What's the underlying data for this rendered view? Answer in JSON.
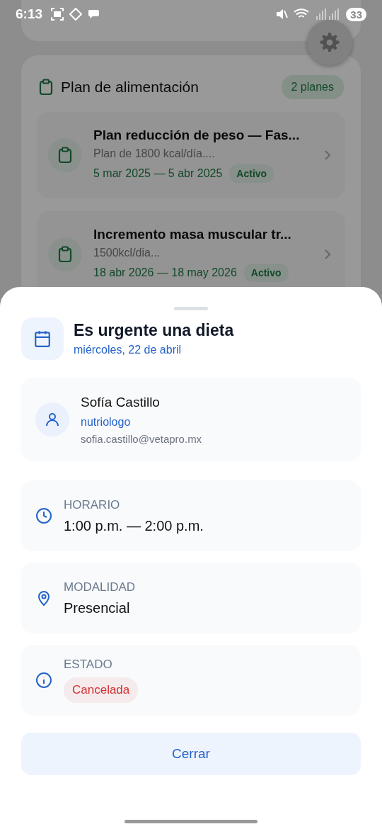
{
  "status_bar": {
    "time": "6:13",
    "battery": "33"
  },
  "plan_card": {
    "title": "Plan de alimentación",
    "badge": "2 planes",
    "plans": [
      {
        "title": "Plan reducción de peso — Fas...",
        "description": "Plan de 1800 kcal/día....",
        "dates": "5 mar 2025 — 5 abr 2025",
        "status": "Activo"
      },
      {
        "title": "Incremento masa muscular tr...",
        "description": "1500kcl/dia...",
        "dates": "18 abr 2026 — 18 may 2026",
        "status": "Activo"
      }
    ]
  },
  "sheet": {
    "title": "Es urgente una dieta",
    "date": "miércoles, 22 de abril",
    "contact": {
      "name": "Sofía Castillo",
      "role": "nutriologo",
      "email": "sofia.castillo@vetapro.mx"
    },
    "details": [
      {
        "kind": "time",
        "label": "HORARIO",
        "value": "1:00 p.m. — 2:00 p.m."
      },
      {
        "kind": "location",
        "label": "MODALIDAD",
        "value": "Presencial"
      },
      {
        "kind": "status",
        "label": "ESTADO",
        "value": "Cancelada",
        "color": "#d32f2f"
      }
    ],
    "close_button": "Cerrar"
  }
}
